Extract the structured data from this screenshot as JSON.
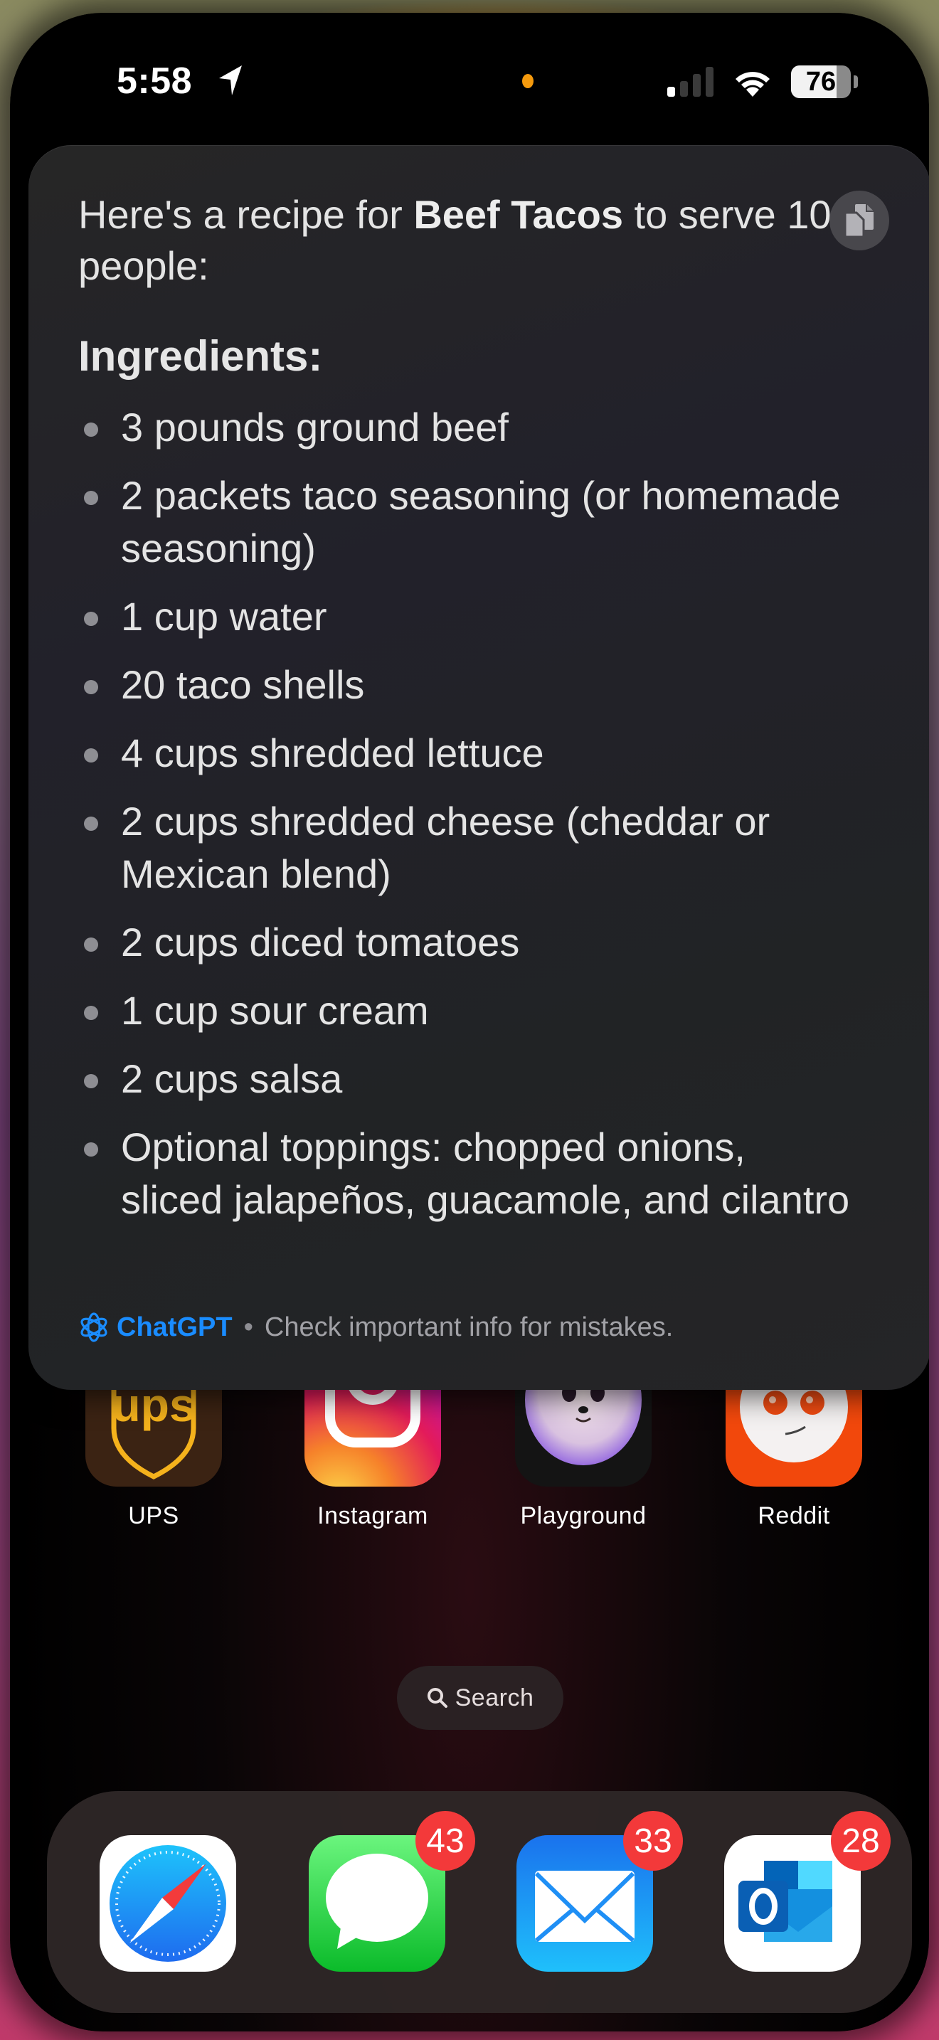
{
  "status_bar": {
    "time": "5:58",
    "location_icon": "location-arrow-icon",
    "signal_bars_active": 1,
    "signal_bars_total": 4,
    "wifi_icon": "wifi-icon",
    "battery_percent": 76,
    "battery_label": "76"
  },
  "card": {
    "intro_before": "Here's a recipe for ",
    "intro_bold": "Beef Tacos",
    "intro_after": " to serve 10 people:",
    "copy_icon": "copy-icon",
    "heading": "Ingredients:",
    "ingredients": [
      "3 pounds ground beef",
      "2 packets taco seasoning (or homemade seasoning)",
      "1 cup water",
      "20 taco shells",
      "4 cups shredded lettuce",
      "2 cups shredded cheese (cheddar or Mexican blend)",
      "2 cups diced tomatoes",
      "1 cup sour cream",
      "2 cups salsa",
      "Optional toppings: chopped onions, sliced jalapeños, guacamole, and cilantro"
    ],
    "footer": {
      "brand_icon": "chatgpt-logo-icon",
      "brand": "ChatGPT",
      "separator": "•",
      "note": "Check important info for mistakes."
    },
    "brand_color": "#1a8cff"
  },
  "home_apps": [
    {
      "name": "UPS",
      "icon": "ups-icon"
    },
    {
      "name": "Instagram",
      "icon": "instagram-icon"
    },
    {
      "name": "Playground",
      "icon": "playground-icon"
    },
    {
      "name": "Reddit",
      "icon": "reddit-icon"
    }
  ],
  "search": {
    "label": "Search",
    "icon": "search-icon"
  },
  "dock": [
    {
      "name": "Safari",
      "icon": "safari-icon",
      "badge": null
    },
    {
      "name": "Messages",
      "icon": "messages-icon",
      "badge": "43"
    },
    {
      "name": "Mail",
      "icon": "mail-icon",
      "badge": "33"
    },
    {
      "name": "Outlook",
      "icon": "outlook-icon",
      "badge": "28"
    }
  ],
  "colors": {
    "badge": "#f3393a",
    "island_indicator": "#f59a0d"
  }
}
